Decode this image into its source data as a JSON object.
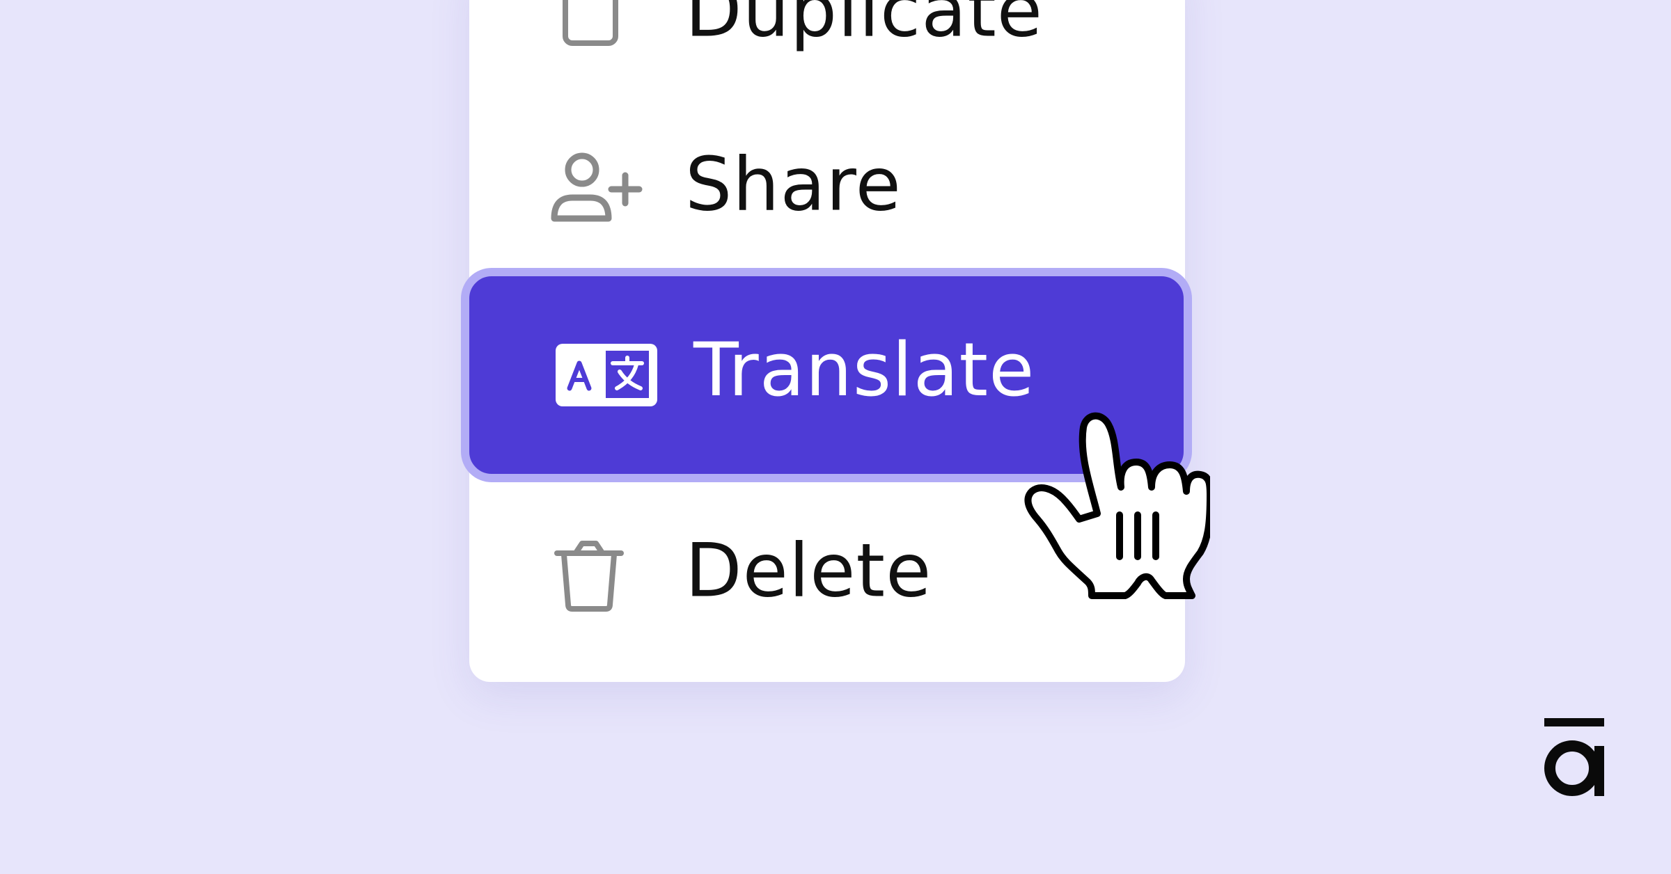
{
  "menu": {
    "items": [
      {
        "id": "duplicate",
        "label": "Duplicate",
        "icon": "duplicate-icon",
        "active": false
      },
      {
        "id": "share",
        "label": "Share",
        "icon": "add-user-icon",
        "active": false
      },
      {
        "id": "translate",
        "label": "Translate",
        "icon": "translate-icon",
        "active": true
      },
      {
        "id": "delete",
        "label": "Delete",
        "icon": "trash-icon",
        "active": false
      }
    ]
  },
  "colors": {
    "background": "#e7e5fb",
    "card": "#ffffff",
    "active_fill": "#4e3bd6",
    "active_border": "#b2acf6",
    "icon_gray": "#8a8a8a",
    "text": "#111111"
  },
  "cursor": {
    "icon": "hand-pointer-cursor-icon"
  },
  "brand": {
    "icon": "brand-logo-icon"
  }
}
